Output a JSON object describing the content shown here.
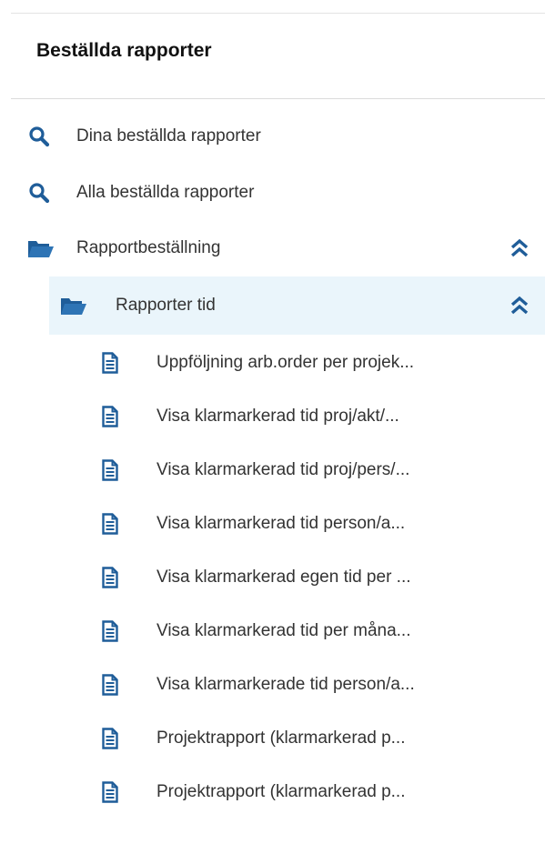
{
  "panel": {
    "title": "Beställda rapporter"
  },
  "searches": [
    {
      "label": "Dina beställda rapporter",
      "icon": "search-icon"
    },
    {
      "label": "Alla beställda rapporter",
      "icon": "search-icon"
    }
  ],
  "folders": [
    {
      "label": "Rapportbeställning",
      "icon": "folder-open-icon",
      "toggle_icon": "chevron-double-up-icon"
    },
    {
      "label": "Rapporter tid",
      "icon": "folder-open-icon",
      "toggle_icon": "chevron-double-up-icon"
    }
  ],
  "reports": [
    {
      "label": "Uppföljning arb.order per projek...",
      "icon": "document-icon"
    },
    {
      "label": "Visa klarmarkerad tid proj/akt/...",
      "icon": "document-icon"
    },
    {
      "label": "Visa klarmarkerad tid proj/pers/...",
      "icon": "document-icon"
    },
    {
      "label": "Visa klarmarkerad tid person/a...",
      "icon": "document-icon"
    },
    {
      "label": "Visa klarmarkerad egen tid per ...",
      "icon": "document-icon"
    },
    {
      "label": "Visa klarmarkerad tid per måna...",
      "icon": "document-icon"
    },
    {
      "label": "Visa klarmarkerade tid person/a...",
      "icon": "document-icon"
    },
    {
      "label": "Projektrapport (klarmarkerad p...",
      "icon": "document-icon"
    },
    {
      "label": "Projektrapport (klarmarkerad p...",
      "icon": "document-icon"
    }
  ],
  "colors": {
    "icon_blue": "#1f5d99",
    "selected_bg": "#eaf5fb"
  }
}
